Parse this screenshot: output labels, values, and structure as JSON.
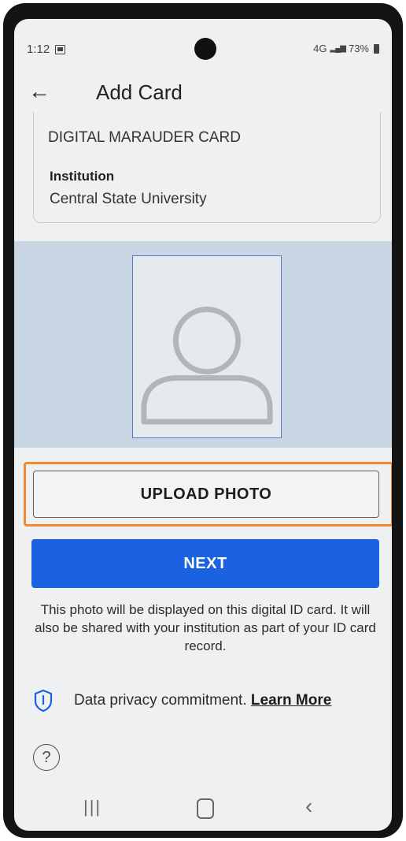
{
  "status_bar": {
    "time": "1:12",
    "network": "4G",
    "battery": "73%"
  },
  "app_bar": {
    "title": "Add Card"
  },
  "card": {
    "name": "DIGITAL MARAUDER CARD",
    "institution_label": "Institution",
    "institution_value": "Central State University"
  },
  "buttons": {
    "upload": "UPLOAD PHOTO",
    "next": "NEXT"
  },
  "info_text": "This photo will be displayed on this digital ID card. It will also be shared with your institution as part of your ID card record.",
  "privacy": {
    "text": "Data privacy commitment.",
    "link": "Learn More"
  },
  "help": {
    "symbol": "?"
  },
  "colors": {
    "primary": "#1a62e0",
    "highlight": "#f08a2e",
    "photo_background": "#c7d6e2"
  },
  "icons": [
    "image-icon",
    "signal-icon",
    "battery-icon",
    "back-arrow-icon",
    "avatar-placeholder-icon",
    "shield-icon",
    "help-icon",
    "nav-recents-icon",
    "nav-home-icon",
    "nav-back-icon"
  ]
}
